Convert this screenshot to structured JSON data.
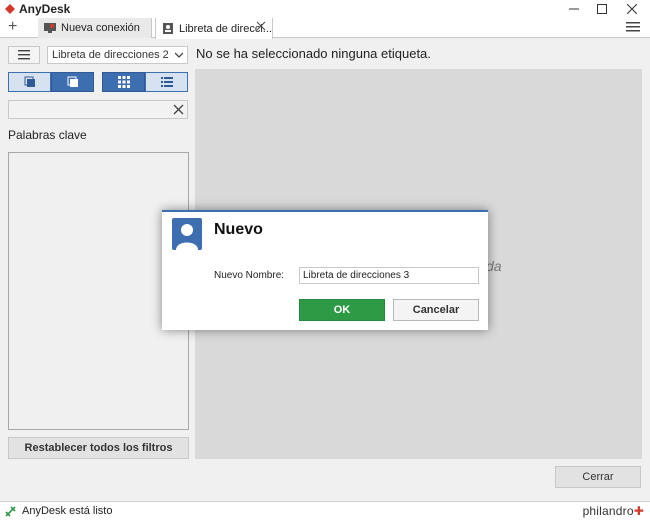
{
  "window": {
    "title": "AnyDesk",
    "brand_color": "#d43a2c",
    "controls": [
      "minimize-icon",
      "maximize-icon",
      "close-icon"
    ]
  },
  "tabs": [
    {
      "label": "Nueva conexión",
      "icon": "monitor-icon",
      "active": false
    },
    {
      "label": "Libreta de direcci...",
      "icon": "address-book-icon",
      "active": true
    }
  ],
  "toolbar": {
    "address_book_selected": "Libreta de direcciones 2",
    "tag_status": "No se ha seleccionado ninguna etiqueta."
  },
  "sidebar": {
    "view_buttons": [
      "tile-view-icon",
      "list-view-icon",
      "grid-icon",
      "details-icon"
    ],
    "search_value": "",
    "keywords_label": "Palabras clave",
    "reset_filters_label": "Restablecer todos los filtros"
  },
  "main": {
    "background_text_fragment": "da"
  },
  "footer": {
    "close_label": "Cerrar"
  },
  "statusbar": {
    "text": "AnyDesk está listo",
    "brand": "philandro"
  },
  "dialog": {
    "title": "Nuevo",
    "name_label": "Nuevo Nombre:",
    "name_value": "Libreta de direcciones 3",
    "ok_label": "OK",
    "cancel_label": "Cancelar",
    "accent_color": "#3d6fb0",
    "ok_color": "#2e9a46"
  }
}
